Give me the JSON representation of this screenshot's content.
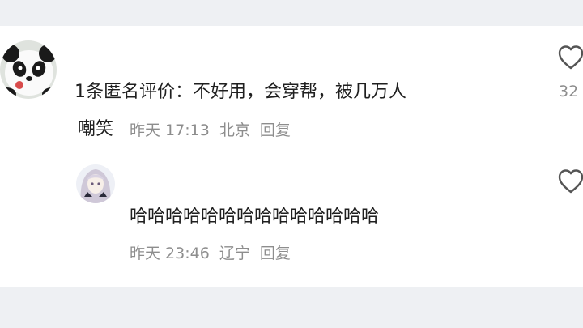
{
  "comments": [
    {
      "text_line1": "1条匿名评价：不好用，会穿帮，被几万人",
      "text_line2": "嘲笑",
      "time": "昨天 17:13",
      "location": "北京",
      "reply_label": "回复",
      "likes": "32",
      "avatar_icon": "panda-avatar-icon"
    },
    {
      "text": "哈哈哈哈哈哈哈哈哈哈哈哈哈哈",
      "time": "昨天 23:46",
      "location": "辽宁",
      "reply_label": "回复",
      "avatar_icon": "anime-girl-avatar-icon"
    }
  ],
  "colors": {
    "background": "#eef0f3",
    "card": "#ffffff",
    "text": "#1f1f1f",
    "meta": "#8d8d8d"
  }
}
